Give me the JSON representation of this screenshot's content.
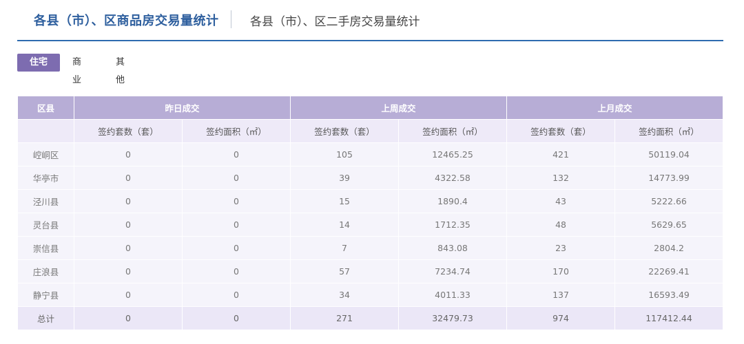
{
  "header": {
    "tab_main": "各县（市）、区商品房交易量统计",
    "tab_second": "各县（市）、区二手房交易量统计"
  },
  "subtabs": [
    "住宅",
    "商业",
    "其他"
  ],
  "table": {
    "group_headers": [
      "区县",
      "昨日成交",
      "上周成交",
      "上月成交"
    ],
    "sub_headers": [
      "签约套数（套）",
      "签约面积（㎡）",
      "签约套数（套）",
      "签约面积（㎡）",
      "签约套数（套）",
      "签约面积（㎡）"
    ],
    "rows": [
      [
        "崆峒区",
        "0",
        "0",
        "105",
        "12465.25",
        "421",
        "50119.04"
      ],
      [
        "华亭市",
        "0",
        "0",
        "39",
        "4322.58",
        "132",
        "14773.99"
      ],
      [
        "泾川县",
        "0",
        "0",
        "15",
        "1890.4",
        "43",
        "5222.66"
      ],
      [
        "灵台县",
        "0",
        "0",
        "14",
        "1712.35",
        "48",
        "5629.65"
      ],
      [
        "崇信县",
        "0",
        "0",
        "7",
        "843.08",
        "23",
        "2804.2"
      ],
      [
        "庄浪县",
        "0",
        "0",
        "57",
        "7234.74",
        "170",
        "22269.41"
      ],
      [
        "静宁县",
        "0",
        "0",
        "34",
        "4011.33",
        "137",
        "16593.49"
      ]
    ],
    "total": [
      "总计",
      "0",
      "0",
      "271",
      "32479.73",
      "974",
      "117412.44"
    ]
  }
}
